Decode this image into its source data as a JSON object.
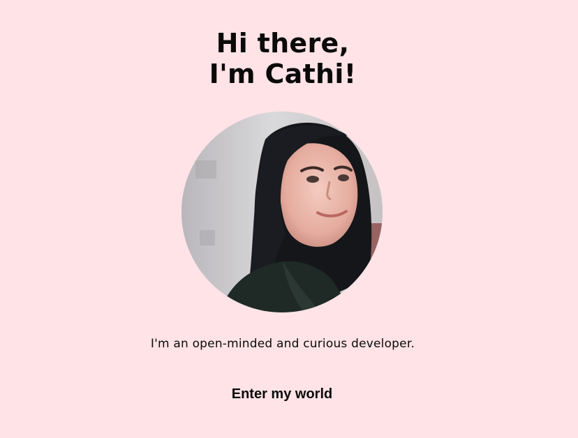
{
  "hero": {
    "greeting_line1": "Hi there,",
    "greeting_line2": "I'm Cathi!",
    "tagline": "I'm an open-minded and curious developer.",
    "cta_label": "Enter my world"
  },
  "portrait": {
    "icon": "profile-photo"
  },
  "colors": {
    "background": "#ffe3e6",
    "text": "#0a0a0a"
  }
}
